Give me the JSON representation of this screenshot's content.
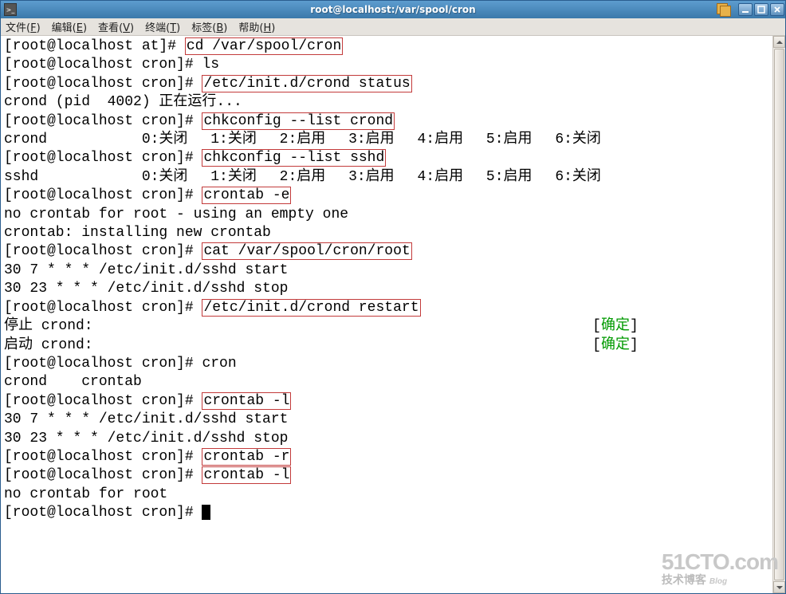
{
  "window": {
    "title": "root@localhost:/var/spool/cron"
  },
  "menubar": {
    "items": [
      {
        "label": "文件",
        "hotkey": "F"
      },
      {
        "label": "编辑",
        "hotkey": "E"
      },
      {
        "label": "查看",
        "hotkey": "V"
      },
      {
        "label": "终端",
        "hotkey": "T"
      },
      {
        "label": "标签",
        "hotkey": "B"
      },
      {
        "label": "帮助",
        "hotkey": "H"
      }
    ]
  },
  "prompts": {
    "at": "[root@localhost at]# ",
    "cron": "[root@localhost cron]# "
  },
  "cmds": {
    "cd": "cd /var/spool/cron",
    "ls": "ls",
    "status": "/etc/init.d/crond status",
    "chk_crond": "chkconfig --list crond",
    "chk_sshd": "chkconfig --list sshd",
    "crontab_e": "crontab -e",
    "cat_root": "cat /var/spool/cron/root",
    "restart": "/etc/init.d/crond restart",
    "cron_tab": "cron",
    "crontab_l": "crontab -l",
    "crontab_r": "crontab -r",
    "crontab_l2": "crontab -l"
  },
  "output": {
    "status_line": "crond (pid  4002) 正在运行...",
    "chk_crond": "crond          \t0:关闭\t1:关闭\t2:启用\t3:启用\t4:启用\t5:启用\t6:关闭",
    "chk_sshd": "sshd           \t0:关闭\t1:关闭\t2:启用\t3:启用\t4:启用\t5:启用\t6:关闭",
    "no_crontab": "no crontab for root - using an empty one",
    "installing": "crontab: installing new crontab",
    "cat1": "30 7 * * * /etc/init.d/sshd start",
    "cat2": "30 23 * * * /etc/init.d/sshd stop",
    "stop_label": "停止 crond:",
    "start_label": "启动 crond:",
    "status_pad": "                                                          ",
    "lb": "[",
    "rb": "]",
    "ok": "确定",
    "cron_compl": "crond    crontab",
    "list1": "30 7 * * * /etc/init.d/sshd start",
    "list2": "30 23 * * * /etc/init.d/sshd stop",
    "no_root": "no crontab for root"
  },
  "watermark": {
    "big": "51CTO.com",
    "small": "技术博客",
    "blog": "Blog"
  }
}
